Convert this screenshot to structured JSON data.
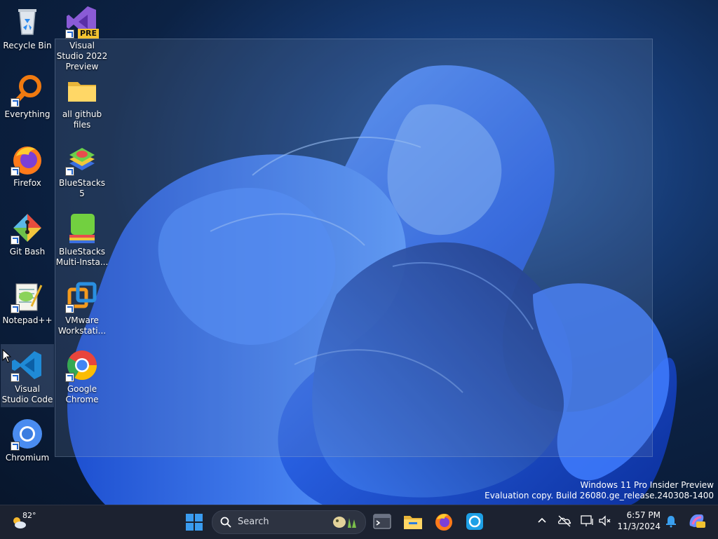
{
  "desktop": {
    "icons": [
      {
        "label": "Recycle Bin"
      },
      {
        "label": "Visual Studio 2022 Preview",
        "badge": "PRE"
      },
      {
        "label": "Everything"
      },
      {
        "label": "all github files"
      },
      {
        "label": "Firefox"
      },
      {
        "label": "BlueStacks 5"
      },
      {
        "label": "Git Bash"
      },
      {
        "label": "BlueStacks Multi-Insta..."
      },
      {
        "label": "Notepad++"
      },
      {
        "label": "VMware Workstati..."
      },
      {
        "label": "Visual Studio Code"
      },
      {
        "label": "Google Chrome"
      },
      {
        "label": "Chromium"
      }
    ],
    "watermark": {
      "line1": "Windows 11 Pro Insider Preview",
      "line2": "Evaluation copy. Build 26080.ge_release.240308-1400"
    }
  },
  "taskbar": {
    "weather": {
      "temp": "82°",
      "icon": "partly-sunny-icon"
    },
    "search": {
      "label": "Search"
    },
    "apps": [
      "start-icon",
      "search-icon",
      "terminal-icon",
      "file-explorer-icon",
      "firefox-icon",
      "sync-app-icon"
    ],
    "tray": [
      "chevron-up-icon",
      "onedrive-off-icon",
      "display-icon",
      "volume-icon",
      "notification-bell-icon",
      "copilot-icon"
    ],
    "clock": {
      "time": "6:57 PM",
      "date": "11/3/2024"
    }
  }
}
